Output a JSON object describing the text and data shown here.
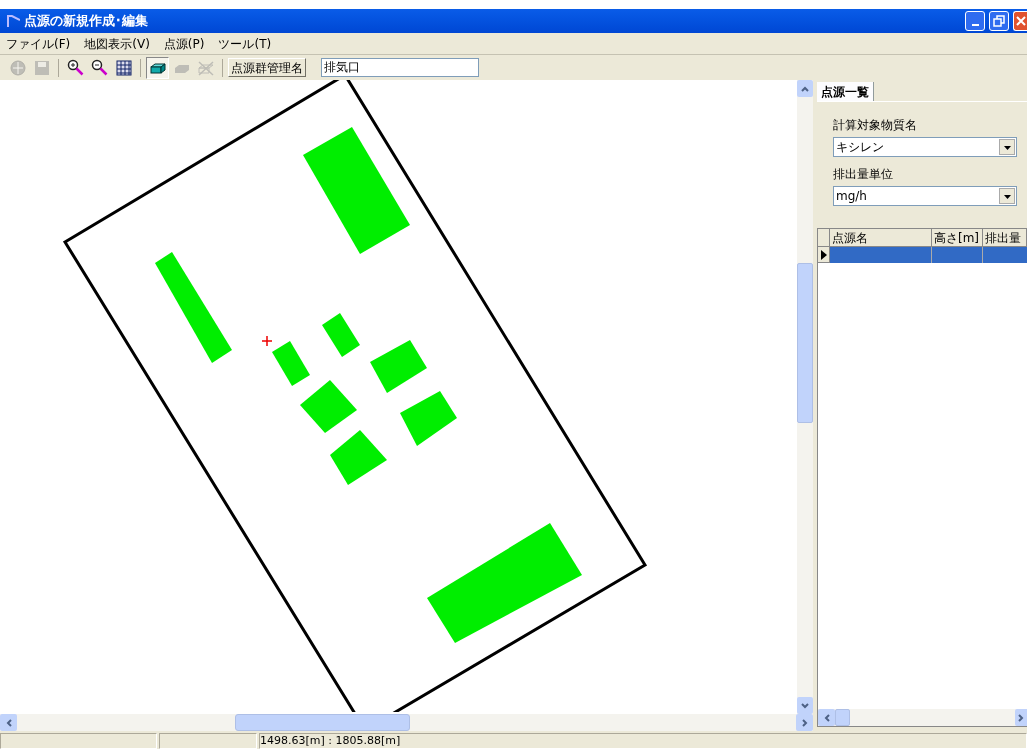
{
  "window": {
    "title": "点源の新規作成･編集"
  },
  "menu": [
    "ファイル(F)",
    "地図表示(V)",
    "点源(P)",
    "ツール(T)"
  ],
  "toolbar": {
    "tools": [
      {
        "kind": "globe",
        "disabled": true,
        "selected": false
      },
      {
        "kind": "save",
        "disabled": true,
        "selected": false
      },
      {
        "kind": "zoom-in",
        "disabled": false,
        "selected": false
      },
      {
        "kind": "zoom-out",
        "disabled": false,
        "selected": false
      },
      {
        "kind": "grid",
        "disabled": false,
        "selected": false
      },
      {
        "kind": "add-block",
        "disabled": false,
        "selected": true
      },
      {
        "kind": "block",
        "disabled": true,
        "selected": false
      },
      {
        "kind": "delete",
        "disabled": true,
        "selected": false
      }
    ],
    "group_button": "点源群管理名",
    "group_field": {
      "value": "排気口"
    }
  },
  "side_panel": {
    "tabs": [
      {
        "label": "点源一覧",
        "selected": true
      }
    ],
    "substance": {
      "label": "計算対象物質名",
      "value": "キシレン"
    },
    "unit": {
      "label": "排出量単位",
      "value": "mg/h"
    },
    "table": {
      "columns": [
        "点源名",
        "高さ[m]",
        "排出量"
      ],
      "rows": [
        {
          "selected": true
        }
      ]
    }
  },
  "status_bar": {
    "coordinates": "1498.63[m] : 1805.88[m]"
  }
}
